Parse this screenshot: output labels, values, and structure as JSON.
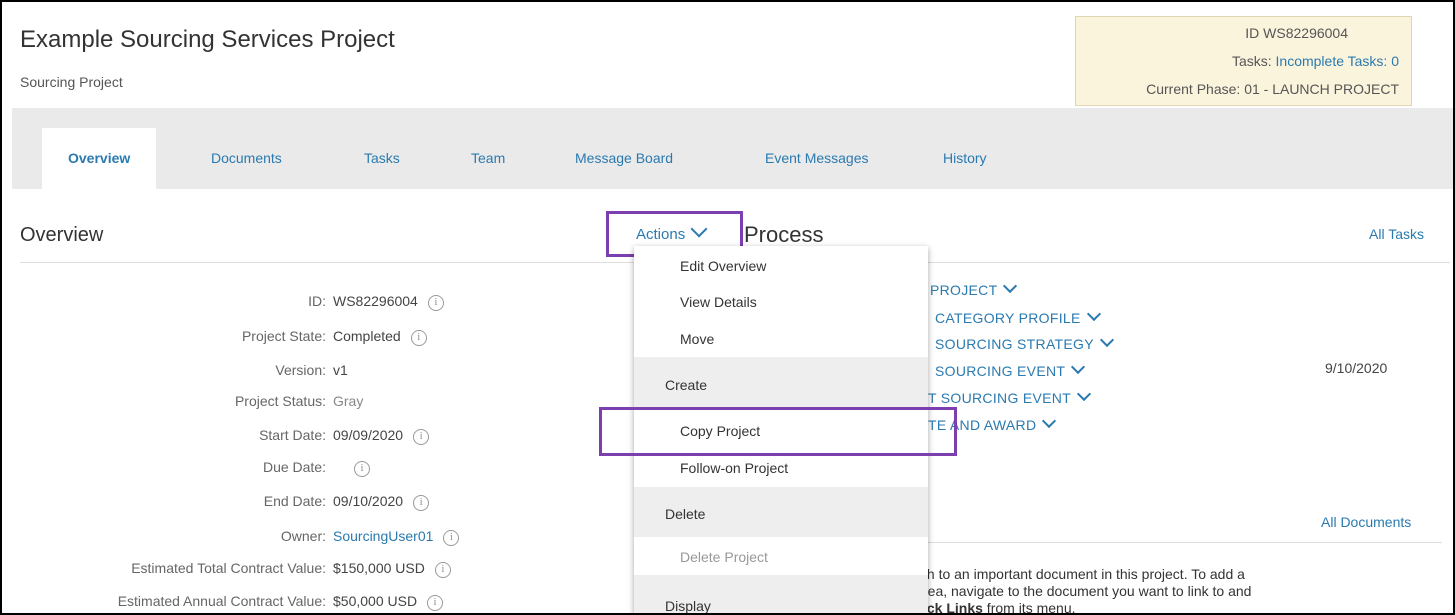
{
  "header": {
    "title": "Example Sourcing Services Project",
    "subtitle": "Sourcing Project"
  },
  "infobox": {
    "id_label": "ID",
    "id_value": "WS82296004",
    "tasks_label": "Tasks:",
    "tasks_value": "Incomplete Tasks: 0",
    "phase_label": "Current Phase:",
    "phase_value": "01 - LAUNCH PROJECT"
  },
  "tabs": [
    "Overview",
    "Documents",
    "Tasks",
    "Team",
    "Message Board",
    "Event Messages",
    "History"
  ],
  "overview": {
    "title": "Overview",
    "actions_label": "Actions",
    "fields": [
      {
        "label": "ID:",
        "value": "WS82296004"
      },
      {
        "label": "Project State:",
        "value": "Completed"
      },
      {
        "label": "Version:",
        "value": "v1"
      },
      {
        "label": "Project Status:",
        "value": "Gray"
      },
      {
        "label": "Start Date:",
        "value": "09/09/2020"
      },
      {
        "label": "Due Date:",
        "value": ""
      },
      {
        "label": "End Date:",
        "value": "09/10/2020"
      },
      {
        "label": "Owner:",
        "value": "SourcingUser01"
      },
      {
        "label": "Estimated Total Contract Value:",
        "value": "$150,000 USD"
      },
      {
        "label": "Estimated Annual Contract Value:",
        "value": "$50,000 USD"
      }
    ]
  },
  "process": {
    "title": "Process",
    "all_tasks": "All Tasks",
    "phases": [
      "PROJECT",
      "CATEGORY PROFILE",
      "SOURCING STRATEGY",
      "SOURCING EVENT",
      "T SOURCING EVENT",
      "TE AND AWARD"
    ],
    "date": "9/10/2020"
  },
  "documents": {
    "all_documents": "All Documents",
    "desc_line1": "th to an important document in this project. To add a",
    "desc_line2": "rea, navigate to the document you want to link to and",
    "desc_line3_bold": "ick Links",
    "desc_line3_rest": " from its menu."
  },
  "menu": {
    "item_edit_overview": "Edit Overview",
    "item_view_details": "View Details",
    "item_move": "Move",
    "header_create": "Create",
    "item_copy_project": "Copy Project",
    "item_follow_on": "Follow-on Project",
    "header_delete": "Delete",
    "item_delete_project": "Delete Project",
    "header_display": "Display"
  },
  "colors": {
    "link": "#2a7ab0",
    "highlight": "#7b3fb0",
    "infobox_bg": "#fbf4dd"
  }
}
